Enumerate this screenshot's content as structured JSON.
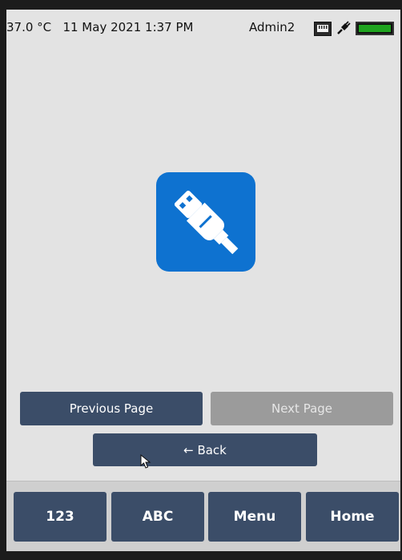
{
  "status": {
    "temperature": "37.0 °C",
    "datetime": "11 May 2021 1:37 PM",
    "user": "Admin2",
    "icons": [
      "network-icon",
      "plug-icon",
      "battery-icon"
    ]
  },
  "main": {
    "icon": "usb-icon"
  },
  "pager": {
    "previous_label": "Previous Page",
    "next_label": "Next Page",
    "back_label": "← Back"
  },
  "nav": {
    "items": [
      {
        "label": "123"
      },
      {
        "label": "ABC"
      },
      {
        "label": "Menu"
      },
      {
        "label": "Home"
      }
    ]
  },
  "colors": {
    "button": "#3b4d68",
    "disabled_button": "#9b9b9b",
    "usb_tile": "#0e72d0",
    "battery": "#1fa41f",
    "background": "#e3e3e3"
  }
}
